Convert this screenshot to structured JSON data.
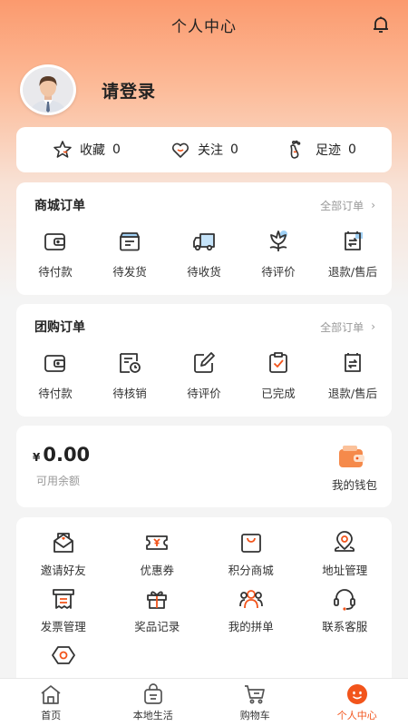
{
  "header": {
    "title": "个人中心",
    "bell_icon": "bell-icon"
  },
  "profile": {
    "login_text": "请登录",
    "avatar_icon": "avatar-man-icon"
  },
  "stats": [
    {
      "label": "收藏",
      "count": "0",
      "icon": "star-icon"
    },
    {
      "label": "关注",
      "count": "0",
      "icon": "heart-icon"
    },
    {
      "label": "足迹",
      "count": "0",
      "icon": "footprint-icon"
    }
  ],
  "mall_orders": {
    "title": "商城订单",
    "link": "全部订单",
    "items": [
      {
        "label": "待付款",
        "icon": "wallet-icon"
      },
      {
        "label": "待发货",
        "icon": "box-icon"
      },
      {
        "label": "待收货",
        "icon": "truck-icon"
      },
      {
        "label": "待评价",
        "icon": "flower-icon"
      },
      {
        "label": "退款/售后",
        "icon": "refund-icon"
      }
    ]
  },
  "group_orders": {
    "title": "团购订单",
    "link": "全部订单",
    "items": [
      {
        "label": "待付款",
        "icon": "wallet-icon"
      },
      {
        "label": "待核销",
        "icon": "voucher-clock-icon"
      },
      {
        "label": "待评价",
        "icon": "edit-icon"
      },
      {
        "label": "已完成",
        "icon": "clipboard-check-icon"
      },
      {
        "label": "退款/售后",
        "icon": "refund-icon"
      }
    ]
  },
  "wallet": {
    "currency": "¥",
    "amount": "0.00",
    "available_label": "可用余额",
    "wallet_label": "我的钱包",
    "icon": "wallet-orange-icon"
  },
  "services": [
    {
      "label": "邀请好友",
      "icon": "invite-envelope-icon"
    },
    {
      "label": "优惠券",
      "icon": "coupon-icon"
    },
    {
      "label": "积分商城",
      "icon": "shopping-bag-icon"
    },
    {
      "label": "地址管理",
      "icon": "location-pin-icon"
    },
    {
      "label": "发票管理",
      "icon": "invoice-icon"
    },
    {
      "label": "奖品记录",
      "icon": "gift-icon"
    },
    {
      "label": "我的拼单",
      "icon": "group-people-icon"
    },
    {
      "label": "联系客服",
      "icon": "headset-icon"
    },
    {
      "label": "",
      "icon": "settings-hexagon-icon"
    }
  ],
  "tabs": [
    {
      "label": "首页",
      "icon": "home-icon",
      "active": false
    },
    {
      "label": "本地生活",
      "icon": "local-life-icon",
      "active": false
    },
    {
      "label": "购物车",
      "icon": "cart-icon",
      "active": false
    },
    {
      "label": "个人中心",
      "icon": "profile-face-icon",
      "active": true
    }
  ],
  "colors": {
    "accent": "#f2541b",
    "gradient_top": "#fb9a6e",
    "icon_stroke": "#333333",
    "icon_highlight": "#9fd0f5"
  }
}
